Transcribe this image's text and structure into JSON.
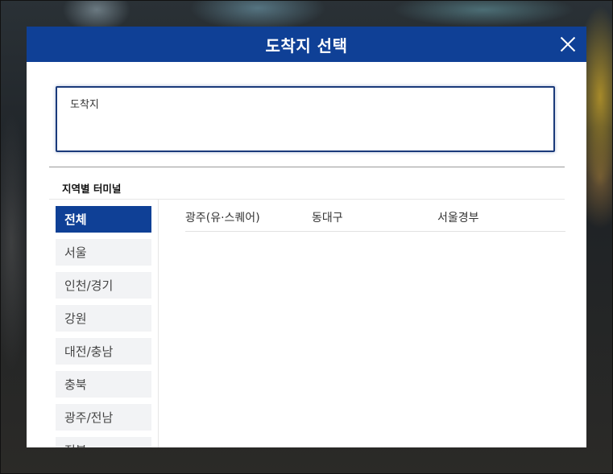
{
  "modal": {
    "title": "도착지 선택"
  },
  "search": {
    "placeholder": "도착지",
    "value": ""
  },
  "regions_section": {
    "title": "지역별 터미널",
    "items": [
      {
        "label": "전체",
        "active": true
      },
      {
        "label": "서울"
      },
      {
        "label": "인천/경기"
      },
      {
        "label": "강원"
      },
      {
        "label": "대전/충남"
      },
      {
        "label": "충북"
      },
      {
        "label": "광주/전남"
      },
      {
        "label": "전북"
      }
    ]
  },
  "terminals": [
    "광주(유·스퀘어)",
    "동대구",
    "서울경부"
  ],
  "colors": {
    "header": "#0f4096",
    "active_item": "#0f4096"
  }
}
